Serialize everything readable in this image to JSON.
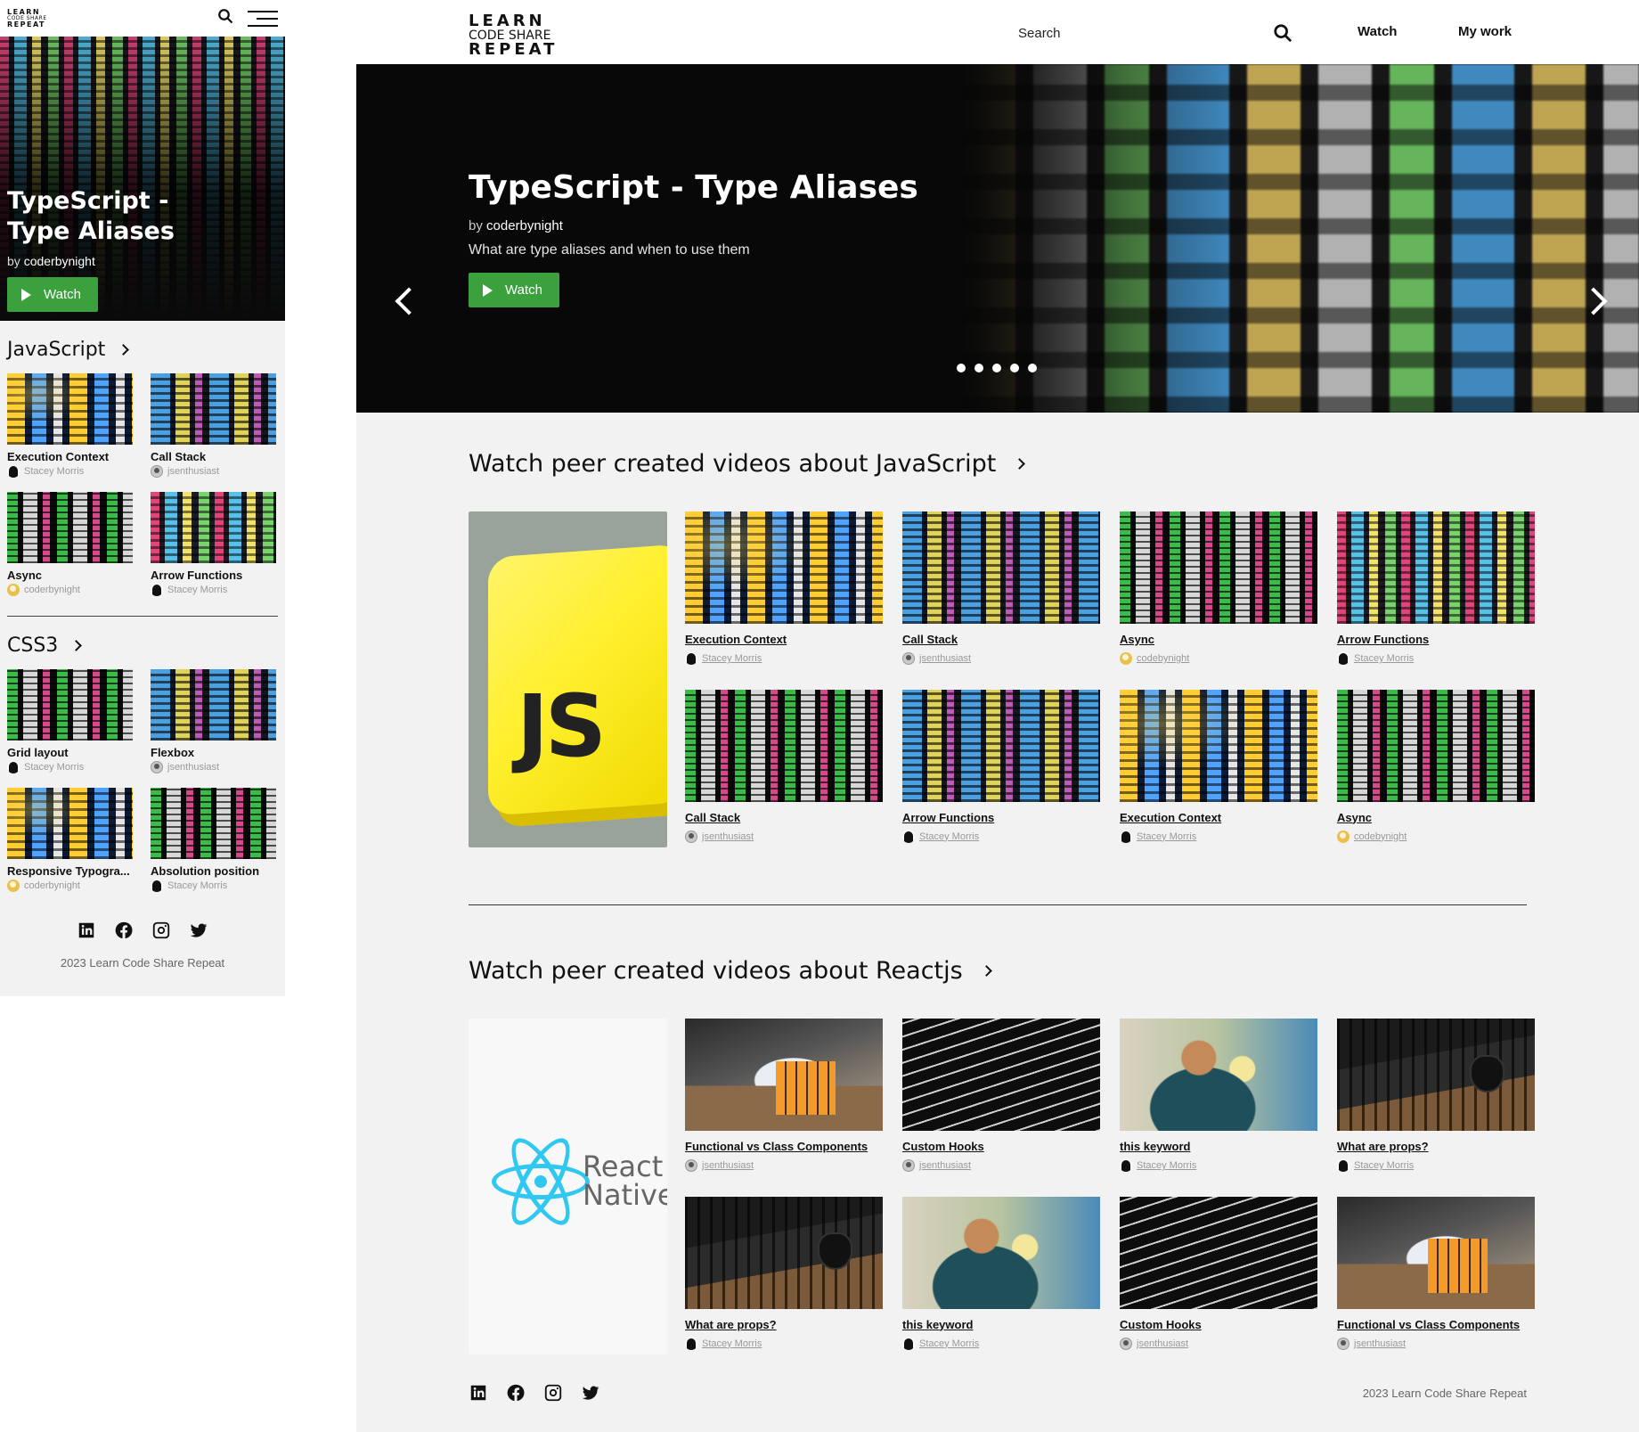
{
  "logo": {
    "line1": "LEARN",
    "line2": "CODE SHARE",
    "line3": "REPEAT"
  },
  "nav": {
    "search_placeholder": "Search",
    "watch": "Watch",
    "my_work": "My work"
  },
  "hero": {
    "title": "TypeScript - Type Aliases",
    "mobile_title_line1": "TypeScript -",
    "mobile_title_line2": "Type Aliases",
    "by_prefix": "by",
    "author": "coderbynight",
    "description": "What are type aliases and  when to use them",
    "watch_label": "Watch",
    "slide_count": 5
  },
  "mobile": {
    "sections": [
      {
        "title": "JavaScript",
        "cards": [
          {
            "title": "Execution Context",
            "author": "Stacey Morris",
            "avatar": "dark"
          },
          {
            "title": "Call Stack",
            "author": "jsenthusiast",
            "avatar": "gray"
          },
          {
            "title": "Async",
            "author": "coderbynight",
            "avatar": "gold"
          },
          {
            "title": "Arrow Functions",
            "author": "Stacey Morris",
            "avatar": "dark"
          }
        ]
      },
      {
        "title": "CSS3",
        "cards": [
          {
            "title": "Grid layout",
            "author": "Stacey Morris",
            "avatar": "dark"
          },
          {
            "title": "Flexbox",
            "author": "jsenthusiast",
            "avatar": "gray"
          },
          {
            "title": "Responsive Typogra...",
            "author": "coderbynight",
            "avatar": "gold"
          },
          {
            "title": "Absolution position",
            "author": "Stacey Morris",
            "avatar": "dark"
          }
        ]
      }
    ]
  },
  "desktop": {
    "sections": [
      {
        "title": "Watch peer created videos about JavaScript",
        "cards": [
          {
            "title": "Execution Context",
            "author": "Stacey Morris",
            "avatar": "dark"
          },
          {
            "title": "Call Stack",
            "author": "jsenthusiast",
            "avatar": "gray"
          },
          {
            "title": "Async",
            "author": "codebynight",
            "avatar": "gold"
          },
          {
            "title": "Arrow Functions",
            "author": "Stacey Morris",
            "avatar": "dark"
          },
          {
            "title": "Call Stack",
            "author": "jsenthusiast",
            "avatar": "gray"
          },
          {
            "title": "Arrow Functions",
            "author": "Stacey Morris",
            "avatar": "dark"
          },
          {
            "title": "Execution Context",
            "author": "Stacey Morris",
            "avatar": "dark"
          },
          {
            "title": "Async",
            "author": "codebynight",
            "avatar": "gold"
          }
        ]
      },
      {
        "title": "Watch peer created videos about Reactjs",
        "feature_line1": "React",
        "feature_line2": "Native",
        "cards": [
          {
            "title": "Functional vs Class Components",
            "author": "jsenthusiast",
            "avatar": "gray"
          },
          {
            "title": "Custom Hooks",
            "author": "jsenthusiast",
            "avatar": "gray"
          },
          {
            "title": "this keyword",
            "author": "Stacey Morris",
            "avatar": "dark"
          },
          {
            "title": "What are props?",
            "author": "Stacey Morris",
            "avatar": "dark"
          },
          {
            "title": "What are props?",
            "author": "Stacey Morris",
            "avatar": "dark"
          },
          {
            "title": "this keyword",
            "author": "Stacey Morris",
            "avatar": "dark"
          },
          {
            "title": "Custom Hooks",
            "author": "jsenthusiast",
            "avatar": "gray"
          },
          {
            "title": "Functional vs Class Components",
            "author": "jsenthusiast",
            "avatar": "gray"
          }
        ]
      }
    ]
  },
  "js_feature_text": "JS",
  "footer": {
    "copyright": "2023 Learn Code Share Repeat",
    "icons": [
      "linkedin-icon",
      "facebook-icon",
      "instagram-icon",
      "twitter-icon"
    ]
  },
  "colors": {
    "accent": "#3aa13c",
    "page_bg": "#f2f2f2",
    "hero_bg": "#080808"
  }
}
